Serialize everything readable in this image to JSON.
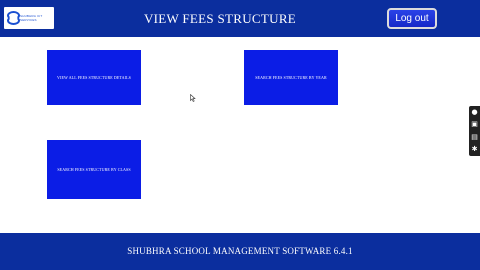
{
  "header": {
    "logo_text": "SHUBHRA ICT\nSERVICES",
    "title": "VIEW FEES STRUCTURE",
    "logout_label": "Log out"
  },
  "tiles": [
    {
      "label": "VIEW ALL FEES STRUCTURE DETAILS"
    },
    {
      "label": "SEARCH FEES STRUCTURE BY  YEAR"
    },
    {
      "label": "SEARCH FEES STRUCTURE BY CLASS"
    }
  ],
  "footer": {
    "text": "SHUBHRA SCHOOL MANAGEMENT SOFTWARE 6.4.1"
  },
  "side_toolbar": {
    "icons": [
      "record-icon",
      "camera-icon",
      "folder-icon",
      "gear-icon"
    ]
  },
  "colors": {
    "header_bg": "#0b2e9e",
    "tile_bg": "#0b1de6",
    "logout_bg": "#1528c8"
  }
}
